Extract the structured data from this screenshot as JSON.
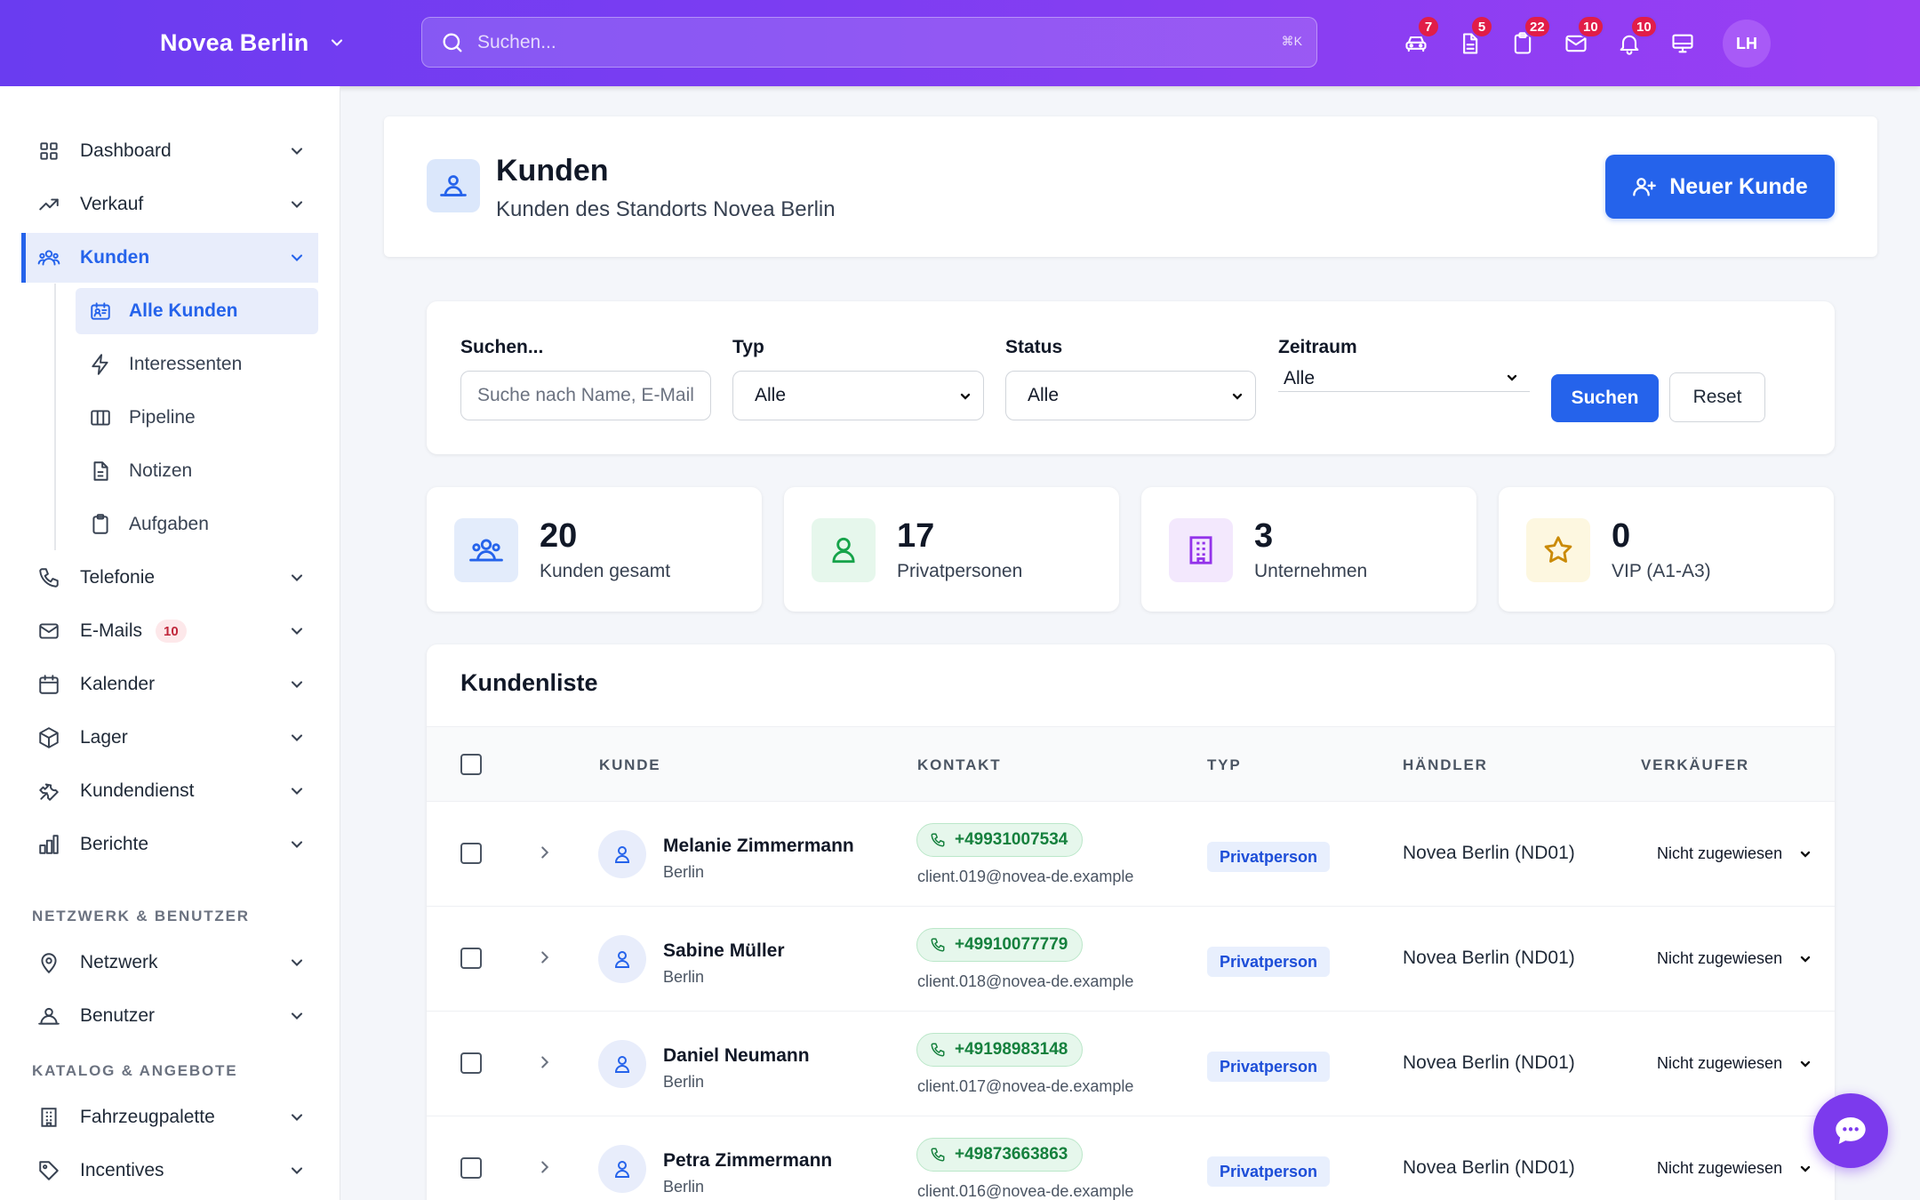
{
  "app": {
    "brand": "Novea Berlin",
    "search_placeholder": "Suchen...",
    "search_shortcut": "⌘K",
    "accent": "#2563eb",
    "header_gradient": [
      "#6a3cf0",
      "#9a3ff3"
    ]
  },
  "top_icons": [
    {
      "icon": "car-icon",
      "badge": "7"
    },
    {
      "icon": "document-icon",
      "badge": "5"
    },
    {
      "icon": "clipboard-icon",
      "badge": "22"
    },
    {
      "icon": "mail-icon",
      "badge": "10"
    },
    {
      "icon": "bell-icon",
      "badge": "10"
    },
    {
      "icon": "monitor-icon",
      "badge": ""
    }
  ],
  "user": {
    "initials": "LH"
  },
  "sidebar": {
    "items": [
      {
        "label": "Dashboard",
        "icon": "grid-icon"
      },
      {
        "label": "Verkauf",
        "icon": "trending-up-icon"
      },
      {
        "label": "Kunden",
        "icon": "users-icon",
        "active": true
      },
      {
        "label": "Telefonie",
        "icon": "phone-icon"
      },
      {
        "label": "E-Mails",
        "icon": "mail-icon",
        "badge": "10"
      },
      {
        "label": "Kalender",
        "icon": "calendar-icon"
      },
      {
        "label": "Lager",
        "icon": "box-icon"
      },
      {
        "label": "Kundendienst",
        "icon": "tools-icon"
      },
      {
        "label": "Berichte",
        "icon": "bar-chart-icon"
      }
    ],
    "sub_items": [
      {
        "label": "Alle Kunden",
        "icon": "contact-card-icon",
        "active": true
      },
      {
        "label": "Interessenten",
        "icon": "bolt-icon"
      },
      {
        "label": "Pipeline",
        "icon": "columns-icon"
      },
      {
        "label": "Notizen",
        "icon": "document-icon"
      },
      {
        "label": "Aufgaben",
        "icon": "clipboard-icon"
      }
    ],
    "section_network": "NETZWERK & BENUTZER",
    "network_items": [
      {
        "label": "Netzwerk",
        "icon": "map-pin-icon"
      },
      {
        "label": "Benutzer",
        "icon": "user-group-icon"
      }
    ],
    "section_catalog": "KATALOG & ANGEBOTE",
    "catalog_items": [
      {
        "label": "Fahrzeugpalette",
        "icon": "building-icon"
      },
      {
        "label": "Incentives",
        "icon": "tag-icon"
      }
    ]
  },
  "page": {
    "title": "Kunden",
    "subtitle": "Kunden des Standorts Novea Berlin",
    "new_button": "Neuer Kunde"
  },
  "filters": {
    "search_label": "Suchen...",
    "search_placeholder": "Suche nach Name, E-Mail...",
    "type_label": "Typ",
    "type_value": "Alle",
    "status_label": "Status",
    "status_value": "Alle",
    "period_label": "Zeitraum",
    "period_value": "Alle",
    "search_button": "Suchen",
    "reset_button": "Reset"
  },
  "stats": [
    {
      "value": "20",
      "label": "Kunden gesamt",
      "icon": "users-icon",
      "color": "#2563eb"
    },
    {
      "value": "17",
      "label": "Privatpersonen",
      "icon": "user-icon",
      "color": "#16a34a"
    },
    {
      "value": "3",
      "label": "Unternehmen",
      "icon": "building-icon",
      "color": "#9333ea"
    },
    {
      "value": "0",
      "label": "VIP (A1-A3)",
      "icon": "star-icon",
      "color": "#ca8a04"
    }
  ],
  "list": {
    "title": "Kundenliste",
    "columns": [
      "KUNDE",
      "KONTAKT",
      "TYP",
      "HÄNDLER",
      "VERKÄUFER"
    ],
    "rows": [
      {
        "name": "Melanie Zimmermann",
        "city": "Berlin",
        "phone": "+49931007534",
        "email": "client.019@novea-de.example",
        "type": "Privatperson",
        "dealer": "Novea Berlin (ND01)",
        "seller": "Nicht zugewiesen"
      },
      {
        "name": "Sabine Müller",
        "city": "Berlin",
        "phone": "+49910077779",
        "email": "client.018@novea-de.example",
        "type": "Privatperson",
        "dealer": "Novea Berlin (ND01)",
        "seller": "Nicht zugewiesen"
      },
      {
        "name": "Daniel Neumann",
        "city": "Berlin",
        "phone": "+49198983148",
        "email": "client.017@novea-de.example",
        "type": "Privatperson",
        "dealer": "Novea Berlin (ND01)",
        "seller": "Nicht zugewiesen"
      },
      {
        "name": "Petra Zimmermann",
        "city": "Berlin",
        "phone": "+49873663863",
        "email": "client.016@novea-de.example",
        "type": "Privatperson",
        "dealer": "Novea Berlin (ND01)",
        "seller": "Nicht zugewiesen"
      }
    ]
  }
}
